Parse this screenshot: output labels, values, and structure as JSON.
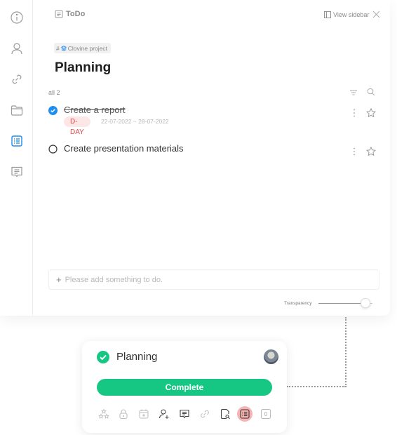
{
  "header": {
    "title": "ToDo",
    "view_sidebar_label": "View sidebar"
  },
  "sidebar": {
    "items": [
      {
        "name": "info",
        "active": false
      },
      {
        "name": "members",
        "active": false
      },
      {
        "name": "links",
        "active": false
      },
      {
        "name": "files",
        "active": false
      },
      {
        "name": "todo",
        "active": true
      },
      {
        "name": "notes",
        "active": false
      }
    ]
  },
  "project": {
    "hash": "#",
    "name": "Clovine project"
  },
  "page_title": "Planning",
  "list": {
    "count_label": "all 2",
    "items": [
      {
        "text": "Create a report",
        "completed": true,
        "badge": "D-DAY",
        "date_range": "22-07-2022 ~ 28-07-2022",
        "starred": false
      },
      {
        "text": "Create presentation materials",
        "completed": false,
        "starred": false
      }
    ]
  },
  "add_input": {
    "value": "",
    "placeholder": "Please add something to do."
  },
  "transparency": {
    "label": "Transparency",
    "value_percent": 87
  },
  "card": {
    "title": "Planning",
    "complete_label": "Complete",
    "tools": [
      {
        "name": "priority",
        "active": false
      },
      {
        "name": "lock",
        "active": false
      },
      {
        "name": "calendar-add",
        "active": false
      },
      {
        "name": "add-member",
        "active": false
      },
      {
        "name": "comment",
        "active": false
      },
      {
        "name": "link",
        "active": false
      },
      {
        "name": "file-search",
        "active": false
      },
      {
        "name": "todo-list",
        "active": true
      },
      {
        "name": "counter",
        "active": false,
        "value": "0"
      }
    ]
  },
  "colors": {
    "accent_blue": "#1e8ef0",
    "complete_green": "#16c784",
    "dday_red": "#e84a4a",
    "active_tool_bg": "#f7b2b2"
  }
}
